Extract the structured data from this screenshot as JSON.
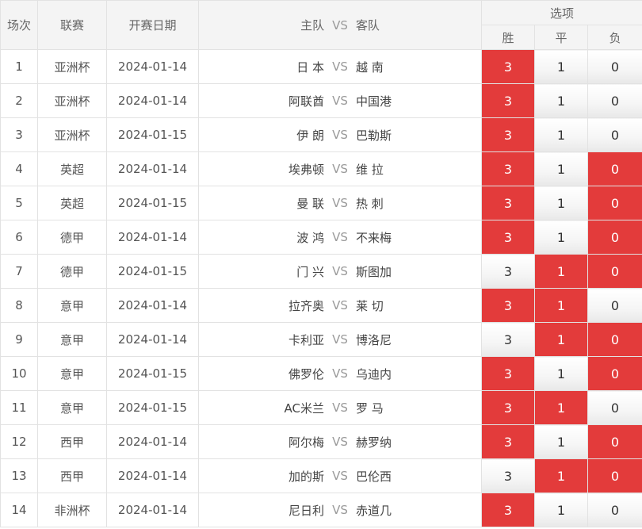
{
  "header": {
    "col_index": "场次",
    "col_league": "联赛",
    "col_date": "开赛日期",
    "col_home": "主队",
    "col_vs": "VS",
    "col_away": "客队",
    "col_options": "选项",
    "opt_win": "胜",
    "opt_draw": "平",
    "opt_lose": "负"
  },
  "colors": {
    "selected": "#e33b3b",
    "unselected": "#f2f2f2"
  },
  "matches": [
    {
      "index": "1",
      "league": "亚洲杯",
      "date": "2024-01-14",
      "home": "日 本",
      "vs": "VS",
      "away": "越 南",
      "options": [
        {
          "label": "3",
          "selected": true
        },
        {
          "label": "1",
          "selected": false
        },
        {
          "label": "0",
          "selected": false
        }
      ]
    },
    {
      "index": "2",
      "league": "亚洲杯",
      "date": "2024-01-14",
      "home": "阿联酋",
      "vs": "VS",
      "away": "中国港",
      "options": [
        {
          "label": "3",
          "selected": true
        },
        {
          "label": "1",
          "selected": false
        },
        {
          "label": "0",
          "selected": false
        }
      ]
    },
    {
      "index": "3",
      "league": "亚洲杯",
      "date": "2024-01-15",
      "home": "伊 朗",
      "vs": "VS",
      "away": "巴勒斯",
      "options": [
        {
          "label": "3",
          "selected": true
        },
        {
          "label": "1",
          "selected": false
        },
        {
          "label": "0",
          "selected": false
        }
      ]
    },
    {
      "index": "4",
      "league": "英超",
      "date": "2024-01-14",
      "home": "埃弗顿",
      "vs": "VS",
      "away": "维 拉",
      "options": [
        {
          "label": "3",
          "selected": true
        },
        {
          "label": "1",
          "selected": false
        },
        {
          "label": "0",
          "selected": true
        }
      ]
    },
    {
      "index": "5",
      "league": "英超",
      "date": "2024-01-15",
      "home": "曼 联",
      "vs": "VS",
      "away": "热 刺",
      "options": [
        {
          "label": "3",
          "selected": true
        },
        {
          "label": "1",
          "selected": false
        },
        {
          "label": "0",
          "selected": true
        }
      ]
    },
    {
      "index": "6",
      "league": "德甲",
      "date": "2024-01-14",
      "home": "波 鸿",
      "vs": "VS",
      "away": "不来梅",
      "options": [
        {
          "label": "3",
          "selected": true
        },
        {
          "label": "1",
          "selected": false
        },
        {
          "label": "0",
          "selected": true
        }
      ]
    },
    {
      "index": "7",
      "league": "德甲",
      "date": "2024-01-15",
      "home": "门 兴",
      "vs": "VS",
      "away": "斯图加",
      "options": [
        {
          "label": "3",
          "selected": false
        },
        {
          "label": "1",
          "selected": true
        },
        {
          "label": "0",
          "selected": true
        }
      ]
    },
    {
      "index": "8",
      "league": "意甲",
      "date": "2024-01-14",
      "home": "拉齐奥",
      "vs": "VS",
      "away": "莱 切",
      "options": [
        {
          "label": "3",
          "selected": true
        },
        {
          "label": "1",
          "selected": true
        },
        {
          "label": "0",
          "selected": false
        }
      ]
    },
    {
      "index": "9",
      "league": "意甲",
      "date": "2024-01-14",
      "home": "卡利亚",
      "vs": "VS",
      "away": "博洛尼",
      "options": [
        {
          "label": "3",
          "selected": false
        },
        {
          "label": "1",
          "selected": true
        },
        {
          "label": "0",
          "selected": true
        }
      ]
    },
    {
      "index": "10",
      "league": "意甲",
      "date": "2024-01-15",
      "home": "佛罗伦",
      "vs": "VS",
      "away": "乌迪内",
      "options": [
        {
          "label": "3",
          "selected": true
        },
        {
          "label": "1",
          "selected": false
        },
        {
          "label": "0",
          "selected": true
        }
      ]
    },
    {
      "index": "11",
      "league": "意甲",
      "date": "2024-01-15",
      "home": "AC米兰",
      "vs": "VS",
      "away": "罗 马",
      "options": [
        {
          "label": "3",
          "selected": true
        },
        {
          "label": "1",
          "selected": true
        },
        {
          "label": "0",
          "selected": false
        }
      ]
    },
    {
      "index": "12",
      "league": "西甲",
      "date": "2024-01-14",
      "home": "阿尔梅",
      "vs": "VS",
      "away": "赫罗纳",
      "options": [
        {
          "label": "3",
          "selected": true
        },
        {
          "label": "1",
          "selected": false
        },
        {
          "label": "0",
          "selected": true
        }
      ]
    },
    {
      "index": "13",
      "league": "西甲",
      "date": "2024-01-14",
      "home": "加的斯",
      "vs": "VS",
      "away": "巴伦西",
      "options": [
        {
          "label": "3",
          "selected": false
        },
        {
          "label": "1",
          "selected": true
        },
        {
          "label": "0",
          "selected": true
        }
      ]
    },
    {
      "index": "14",
      "league": "非洲杯",
      "date": "2024-01-14",
      "home": "尼日利",
      "vs": "VS",
      "away": "赤道几",
      "options": [
        {
          "label": "3",
          "selected": true
        },
        {
          "label": "1",
          "selected": false
        },
        {
          "label": "0",
          "selected": false
        }
      ]
    }
  ]
}
